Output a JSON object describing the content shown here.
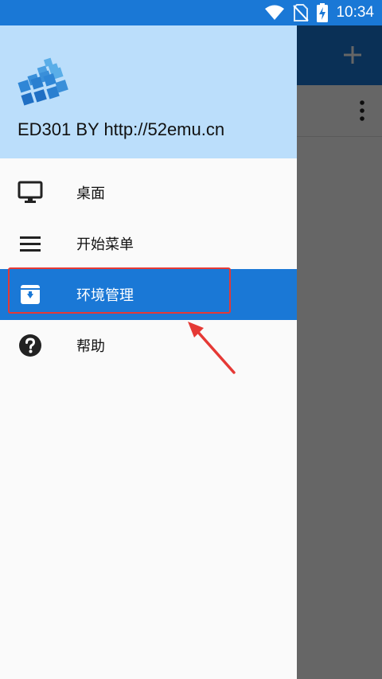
{
  "status_bar": {
    "time": "10:34",
    "icons": [
      "wifi-icon",
      "no-sim-icon",
      "battery-charging-icon"
    ]
  },
  "background_app": {
    "icons": [
      "add-icon",
      "more-vert-icon"
    ]
  },
  "drawer": {
    "header": {
      "logo_icon": "app-logo-icon",
      "title": "ED301 BY http://52emu.cn"
    },
    "items": [
      {
        "id": "desktop",
        "label": "桌面",
        "icon": "monitor-icon",
        "active": false
      },
      {
        "id": "start-menu",
        "label": "开始菜单",
        "icon": "menu-lines-icon",
        "active": false
      },
      {
        "id": "environment",
        "label": "环境管理",
        "icon": "archive-download-icon",
        "active": true
      },
      {
        "id": "help",
        "label": "帮助",
        "icon": "help-circle-icon",
        "active": false
      }
    ]
  },
  "colors": {
    "primary": "#1a78d6",
    "header_bg": "#bbdefb",
    "annotation_red": "#e53935"
  }
}
